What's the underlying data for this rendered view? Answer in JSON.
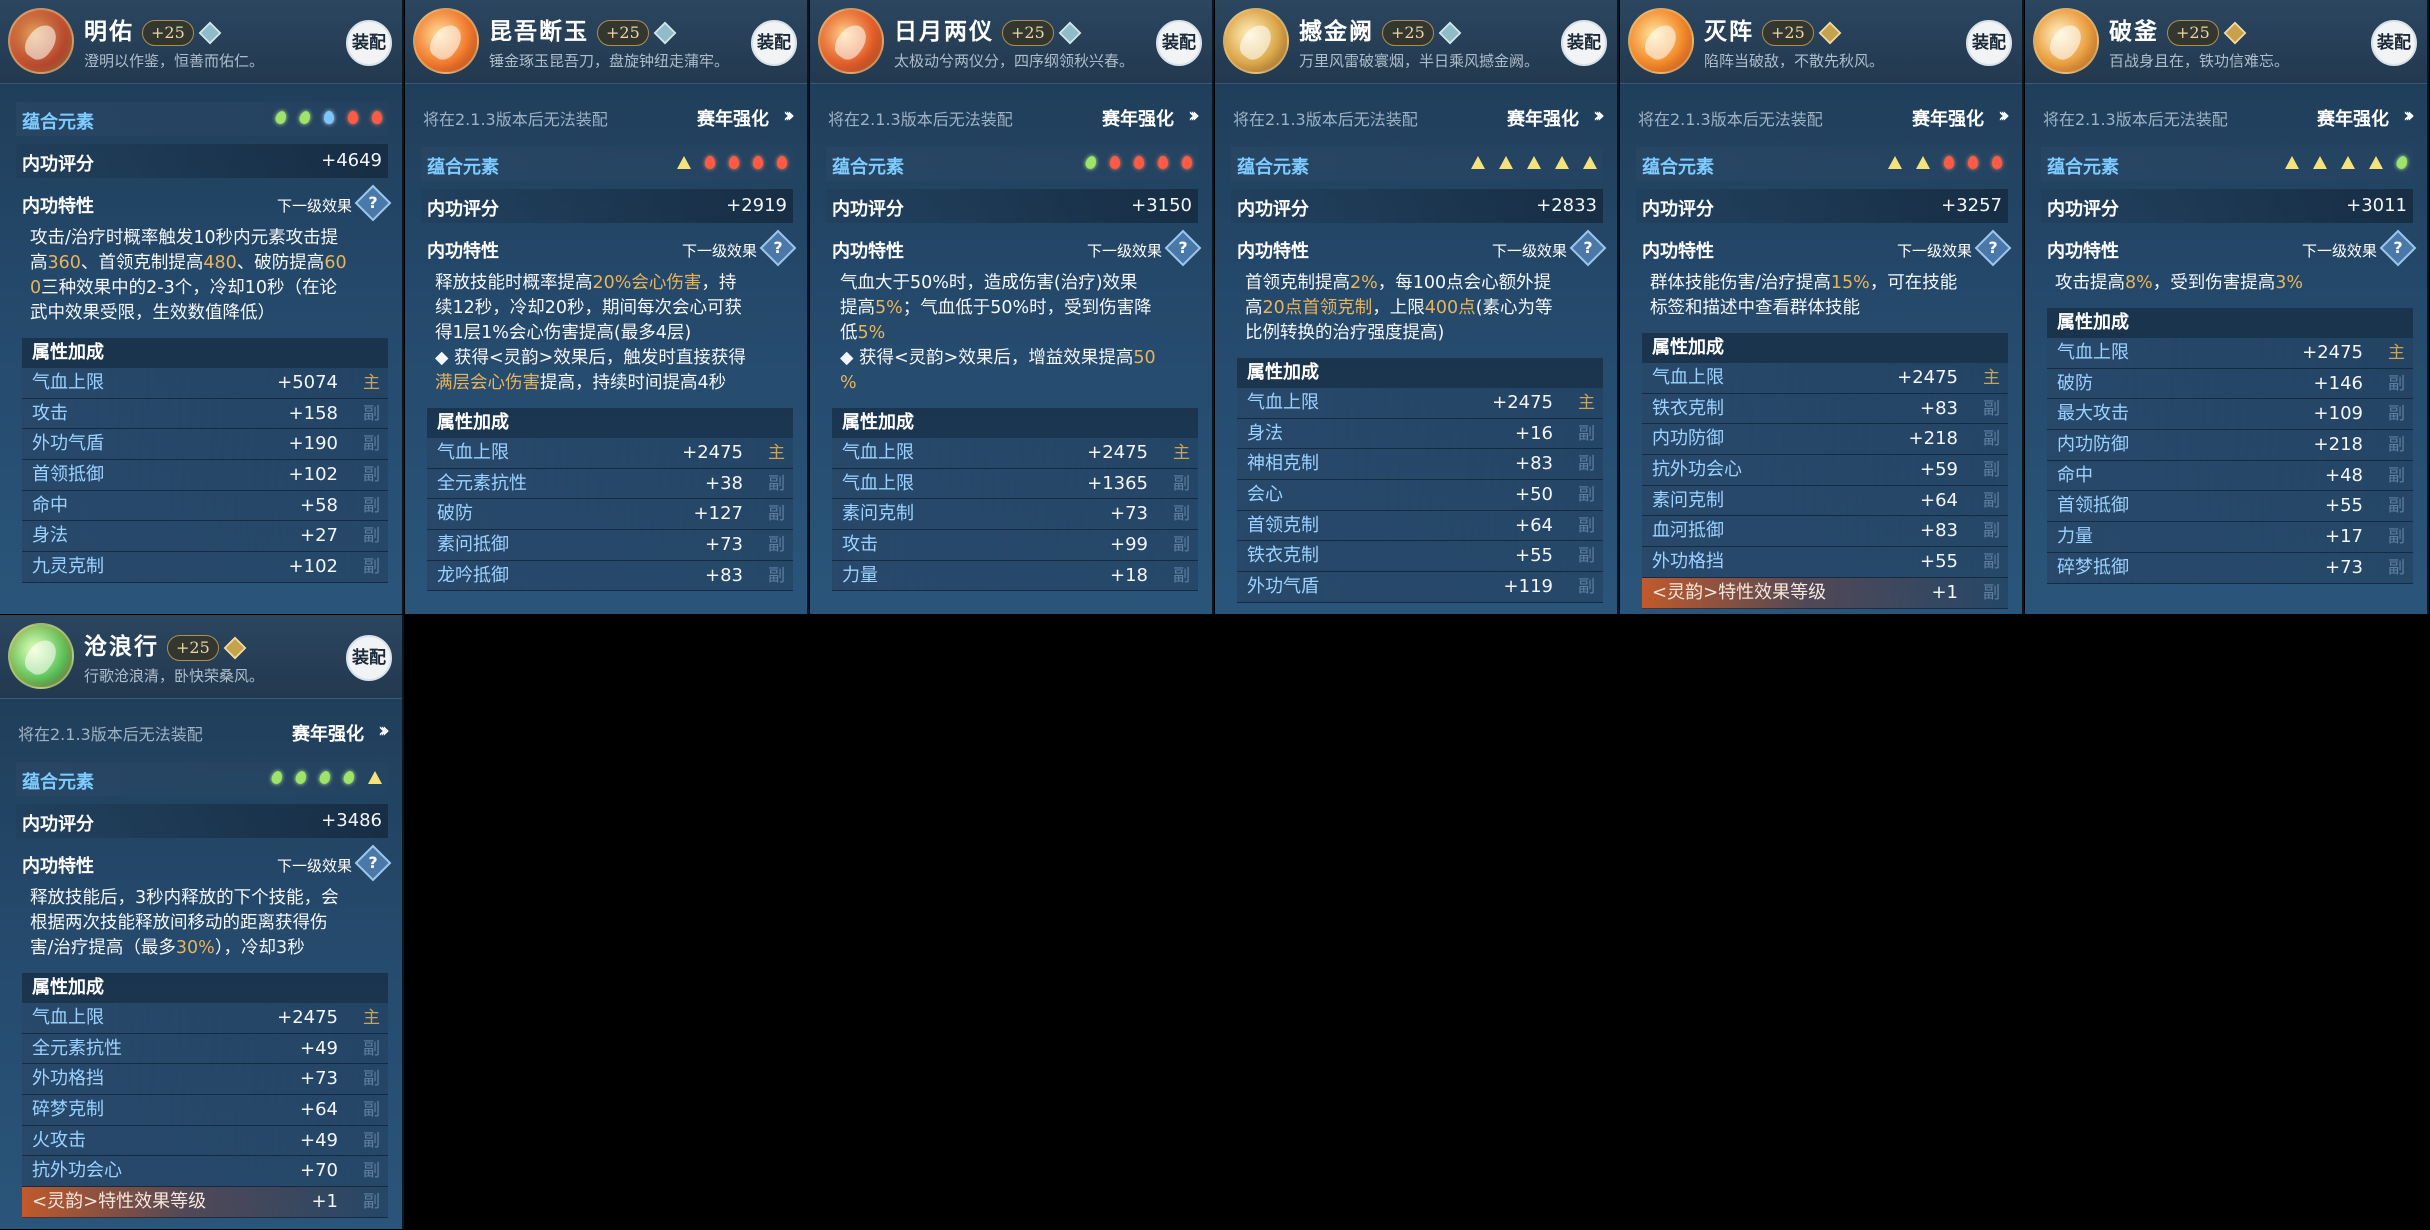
{
  "common": {
    "equip_label": "装配",
    "season_notice": "将在2.1.3版本后无法装配",
    "season_enhance": "赛年强化",
    "elements_label": "蕴合元素",
    "score_label": "内功评分",
    "trait_label": "内功特性",
    "next_level": "下一级效果",
    "attr_title": "属性加成",
    "main_tag": "主",
    "sub_tag": "副"
  },
  "cards": [
    {
      "name": "明佑",
      "level": "+25",
      "motto": "澄明以作鉴，恒善而佑仁。",
      "rank_color": "teal",
      "elements": [
        "green",
        "green",
        "blue",
        "red",
        "red"
      ],
      "score": "+4649",
      "season": false,
      "desc": [
        [
          {
            "t": "攻击/治疗时概率触发10秒内元素攻击提"
          }
        ],
        [
          {
            "t": "高"
          },
          {
            "t": "360",
            "g": 1
          },
          {
            "t": "、首领克制提高"
          },
          {
            "t": "480",
            "g": 1
          },
          {
            "t": "、破防提高"
          },
          {
            "t": "60",
            "g": 1
          }
        ],
        [
          {
            "t": "0",
            "g": 1
          },
          {
            "t": "三种效果中的2-3个，冷却10秒（在论"
          }
        ],
        [
          {
            "t": "武中效果受限，生效数值降低）"
          }
        ]
      ],
      "attrs": [
        {
          "k": "气血上限",
          "v": "+5074",
          "tag": "主"
        },
        {
          "k": "攻击",
          "v": "+158",
          "tag": "副"
        },
        {
          "k": "外功气盾",
          "v": "+190",
          "tag": "副"
        },
        {
          "k": "首领抵御",
          "v": "+102",
          "tag": "副"
        },
        {
          "k": "命中",
          "v": "+58",
          "tag": "副"
        },
        {
          "k": "身法",
          "v": "+27",
          "tag": "副"
        },
        {
          "k": "九灵克制",
          "v": "+102",
          "tag": "副"
        }
      ]
    },
    {
      "name": "昆吾断玉",
      "level": "+25",
      "motto": "锤金琢玉昆吾刀，盘旋钟纽走蒲牢。",
      "rank_color": "teal",
      "elements": [
        "yellow",
        "red",
        "red",
        "red",
        "red"
      ],
      "score": "+2919",
      "season": true,
      "desc": [
        [
          {
            "t": "释放技能时概率提高"
          },
          {
            "t": "20%会心伤害",
            "g": 1
          },
          {
            "t": "，持"
          }
        ],
        [
          {
            "t": "续12秒，冷却20秒，期间每次会心可获"
          }
        ],
        [
          {
            "t": "得1层1%会心伤害提高(最多4层)"
          }
        ],
        [
          {
            "t": "◆ 获得<灵韵>效果后，触发时直接获得"
          }
        ],
        [
          {
            "t": "满层会心伤害",
            "g": 1
          },
          {
            "t": "提高，持续时间提高4秒"
          }
        ]
      ],
      "attrs": [
        {
          "k": "气血上限",
          "v": "+2475",
          "tag": "主"
        },
        {
          "k": "全元素抗性",
          "v": "+38",
          "tag": "副"
        },
        {
          "k": "破防",
          "v": "+127",
          "tag": "副"
        },
        {
          "k": "素问抵御",
          "v": "+73",
          "tag": "副"
        },
        {
          "k": "龙吟抵御",
          "v": "+83",
          "tag": "副"
        }
      ]
    },
    {
      "name": "日月两仪",
      "level": "+25",
      "motto": "太极动兮两仪分，四序纲领秋兴春。",
      "rank_color": "teal",
      "elements": [
        "green",
        "red",
        "red",
        "red",
        "red"
      ],
      "score": "+3150",
      "season": true,
      "desc": [
        [
          {
            "t": "气血大于50%时，造成伤害(治疗)效果"
          }
        ],
        [
          {
            "t": "提高"
          },
          {
            "t": "5%",
            "g": 1
          },
          {
            "t": "；气血低于50%时，受到伤害降"
          }
        ],
        [
          {
            "t": "低"
          },
          {
            "t": "5%",
            "g": 1
          }
        ],
        [
          {
            "t": "◆ 获得<灵韵>效果后，增益效果提高"
          },
          {
            "t": "50",
            "g": 1
          }
        ],
        [
          {
            "t": "%",
            "g": 1
          }
        ]
      ],
      "attrs": [
        {
          "k": "气血上限",
          "v": "+2475",
          "tag": "主"
        },
        {
          "k": "气血上限",
          "v": "+1365",
          "tag": "副"
        },
        {
          "k": "素问克制",
          "v": "+73",
          "tag": "副"
        },
        {
          "k": "攻击",
          "v": "+99",
          "tag": "副"
        },
        {
          "k": "力量",
          "v": "+18",
          "tag": "副"
        }
      ]
    },
    {
      "name": "撼金阙",
      "level": "+25",
      "motto": "万里风雷破寰烟，半日乘风撼金阙。",
      "rank_color": "teal",
      "elements": [
        "yellow",
        "yellow",
        "yellow",
        "yellow",
        "yellow"
      ],
      "score": "+2833",
      "season": true,
      "desc": [
        [
          {
            "t": "首领克制提高"
          },
          {
            "t": "2%",
            "g": 1
          },
          {
            "t": "，每100点会心额外提"
          }
        ],
        [
          {
            "t": "高"
          },
          {
            "t": "20点首领克制",
            "g": 1
          },
          {
            "t": "，上限"
          },
          {
            "t": "400点",
            "g": 1
          },
          {
            "t": "(素心为等"
          }
        ],
        [
          {
            "t": "比例转换的治疗强度提高)"
          }
        ]
      ],
      "attrs": [
        {
          "k": "气血上限",
          "v": "+2475",
          "tag": "主"
        },
        {
          "k": "身法",
          "v": "+16",
          "tag": "副"
        },
        {
          "k": "神相克制",
          "v": "+83",
          "tag": "副"
        },
        {
          "k": "会心",
          "v": "+50",
          "tag": "副"
        },
        {
          "k": "首领克制",
          "v": "+64",
          "tag": "副"
        },
        {
          "k": "铁衣克制",
          "v": "+55",
          "tag": "副"
        },
        {
          "k": "外功气盾",
          "v": "+119",
          "tag": "副"
        }
      ]
    },
    {
      "name": "灭阵",
      "level": "+25",
      "motto": "陷阵当破敌，不散先秋风。",
      "rank_color": "gold",
      "elements": [
        "yellow",
        "yellow",
        "red",
        "red",
        "red"
      ],
      "score": "+3257",
      "season": true,
      "desc": [
        [
          {
            "t": "群体技能伤害/治疗提高"
          },
          {
            "t": "15%",
            "g": 1
          },
          {
            "t": "，可在技能"
          }
        ],
        [
          {
            "t": "标签和描述中查看群体技能"
          }
        ]
      ],
      "attrs": [
        {
          "k": "气血上限",
          "v": "+2475",
          "tag": "主"
        },
        {
          "k": "铁衣克制",
          "v": "+83",
          "tag": "副"
        },
        {
          "k": "内功防御",
          "v": "+218",
          "tag": "副"
        },
        {
          "k": "抗外功会心",
          "v": "+59",
          "tag": "副"
        },
        {
          "k": "素问克制",
          "v": "+64",
          "tag": "副"
        },
        {
          "k": "血河抵御",
          "v": "+83",
          "tag": "副"
        },
        {
          "k": "外功格挡",
          "v": "+55",
          "tag": "副"
        },
        {
          "k": "<灵韵>特性效果等级",
          "v": "+1",
          "tag": "副",
          "special": true
        }
      ]
    },
    {
      "name": "破釜",
      "level": "+25",
      "motto": "百战身且在，铁功信难忘。",
      "rank_color": "gold",
      "elements": [
        "yellow",
        "yellow",
        "yellow",
        "yellow",
        "green"
      ],
      "score": "+3011",
      "season": true,
      "desc": [
        [
          {
            "t": "攻击提高"
          },
          {
            "t": "8%",
            "g": 1
          },
          {
            "t": "，受到伤害提高"
          },
          {
            "t": "3%",
            "g": 1
          }
        ]
      ],
      "attrs": [
        {
          "k": "气血上限",
          "v": "+2475",
          "tag": "主"
        },
        {
          "k": "破防",
          "v": "+146",
          "tag": "副"
        },
        {
          "k": "最大攻击",
          "v": "+109",
          "tag": "副"
        },
        {
          "k": "内功防御",
          "v": "+218",
          "tag": "副"
        },
        {
          "k": "命中",
          "v": "+48",
          "tag": "副"
        },
        {
          "k": "首领抵御",
          "v": "+55",
          "tag": "副"
        },
        {
          "k": "力量",
          "v": "+17",
          "tag": "副"
        },
        {
          "k": "碎梦抵御",
          "v": "+73",
          "tag": "副"
        }
      ]
    },
    {
      "name": "沧浪行",
      "level": "+25",
      "motto": "行歌沧浪清，卧快荣桑风。",
      "rank_color": "gold",
      "elements": [
        "green",
        "green",
        "green",
        "green",
        "yellow"
      ],
      "score": "+3486",
      "season": true,
      "desc": [
        [
          {
            "t": "释放技能后，3秒内释放的下个技能，会"
          }
        ],
        [
          {
            "t": "根据两次技能释放间移动的距离获得伤"
          }
        ],
        [
          {
            "t": "害/治疗提高（最多"
          },
          {
            "t": "30%",
            "g": 1
          },
          {
            "t": "），冷却3秒"
          }
        ]
      ],
      "attrs": [
        {
          "k": "气血上限",
          "v": "+2475",
          "tag": "主"
        },
        {
          "k": "全元素抗性",
          "v": "+49",
          "tag": "副"
        },
        {
          "k": "外功格挡",
          "v": "+73",
          "tag": "副"
        },
        {
          "k": "碎梦克制",
          "v": "+64",
          "tag": "副"
        },
        {
          "k": "火攻击",
          "v": "+49",
          "tag": "副"
        },
        {
          "k": "抗外功会心",
          "v": "+70",
          "tag": "副"
        },
        {
          "k": "<灵韵>特性效果等级",
          "v": "+1",
          "tag": "副",
          "special": true
        }
      ]
    }
  ]
}
